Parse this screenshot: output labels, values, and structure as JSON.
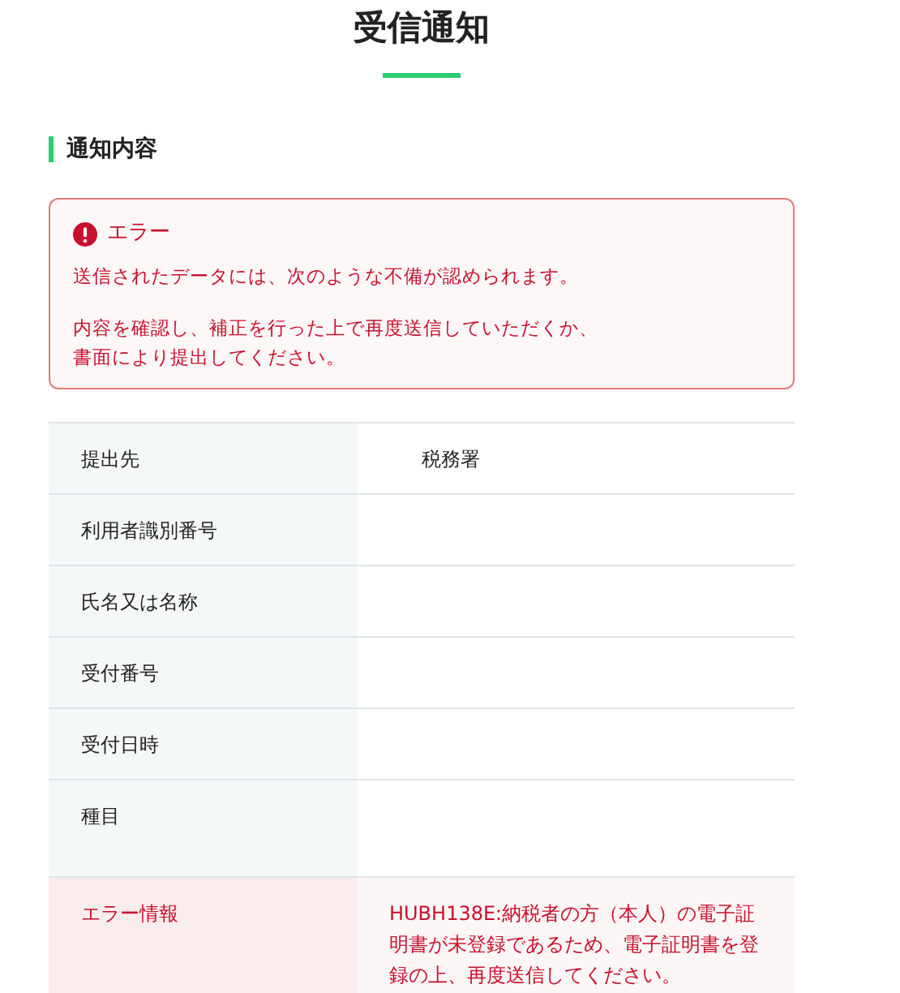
{
  "page": {
    "title": "受信通知"
  },
  "section": {
    "heading": "通知内容"
  },
  "alert": {
    "title": "エラー",
    "paragraphs": [
      [
        "送信されたデータには、次のような不備が認められます。"
      ],
      [
        "内容を確認し、補正を行った上で再度送信していただくか、",
        "書面により提出してください。"
      ]
    ]
  },
  "table": {
    "rows": [
      {
        "kind": "normal",
        "label": "提出先",
        "value": "税務署"
      },
      {
        "kind": "normal",
        "label": "利用者識別番号"
      },
      {
        "kind": "normal",
        "label": "氏名又は名称"
      },
      {
        "kind": "normal",
        "label": "受付番号"
      },
      {
        "kind": "normal",
        "label": "受付日時"
      },
      {
        "kind": "tall",
        "label": "種目"
      },
      {
        "kind": "error",
        "label": "エラー情報",
        "value": "HUBH138E:納税者の方（本人）の電子証明書が未登録であるため、電子証明書を登録の上、再度送信してください。"
      }
    ]
  }
}
